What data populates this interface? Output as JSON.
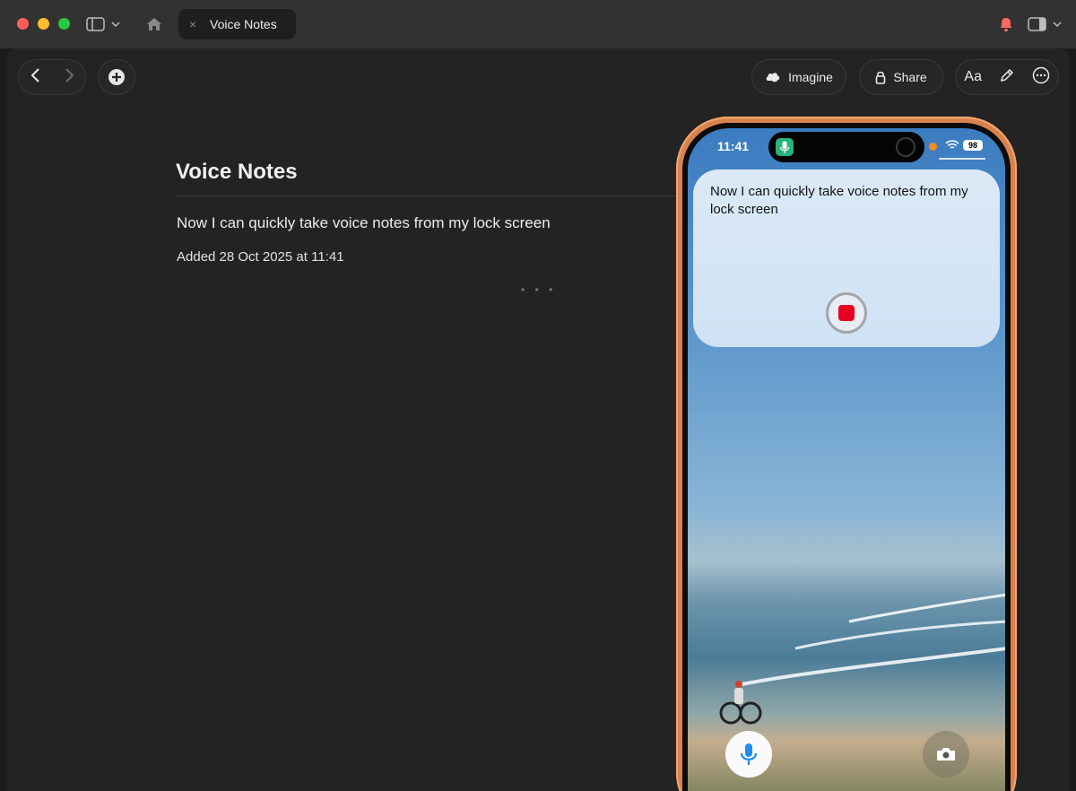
{
  "titlebar": {
    "tab_title": "Voice Notes",
    "tab_close": "×"
  },
  "toolbar": {
    "imagine_label": "Imagine",
    "share_label": "Share",
    "format_label": "Aa"
  },
  "note": {
    "title": "Voice Notes",
    "body": "Now I can quickly take voice notes from my lock screen",
    "meta": "Added 28 Oct 2025 at 11:41",
    "ellipsis": "• • •"
  },
  "phone": {
    "time": "11:41",
    "battery": "98",
    "widget_text": "Now I can quickly take voice notes from my lock screen"
  },
  "colors": {
    "frame": "#d9824e",
    "stop": "#e9001e",
    "island_mic": "#28b37c",
    "mic_icon": "#1f8ef1"
  },
  "icons": [
    "sidebar-icon",
    "home-icon",
    "bell-icon",
    "back-icon",
    "forward-icon",
    "add-icon",
    "imagine-icon",
    "lock-icon",
    "pen-icon",
    "more-icon",
    "mic-icon",
    "camera-icon",
    "wifi-icon"
  ]
}
